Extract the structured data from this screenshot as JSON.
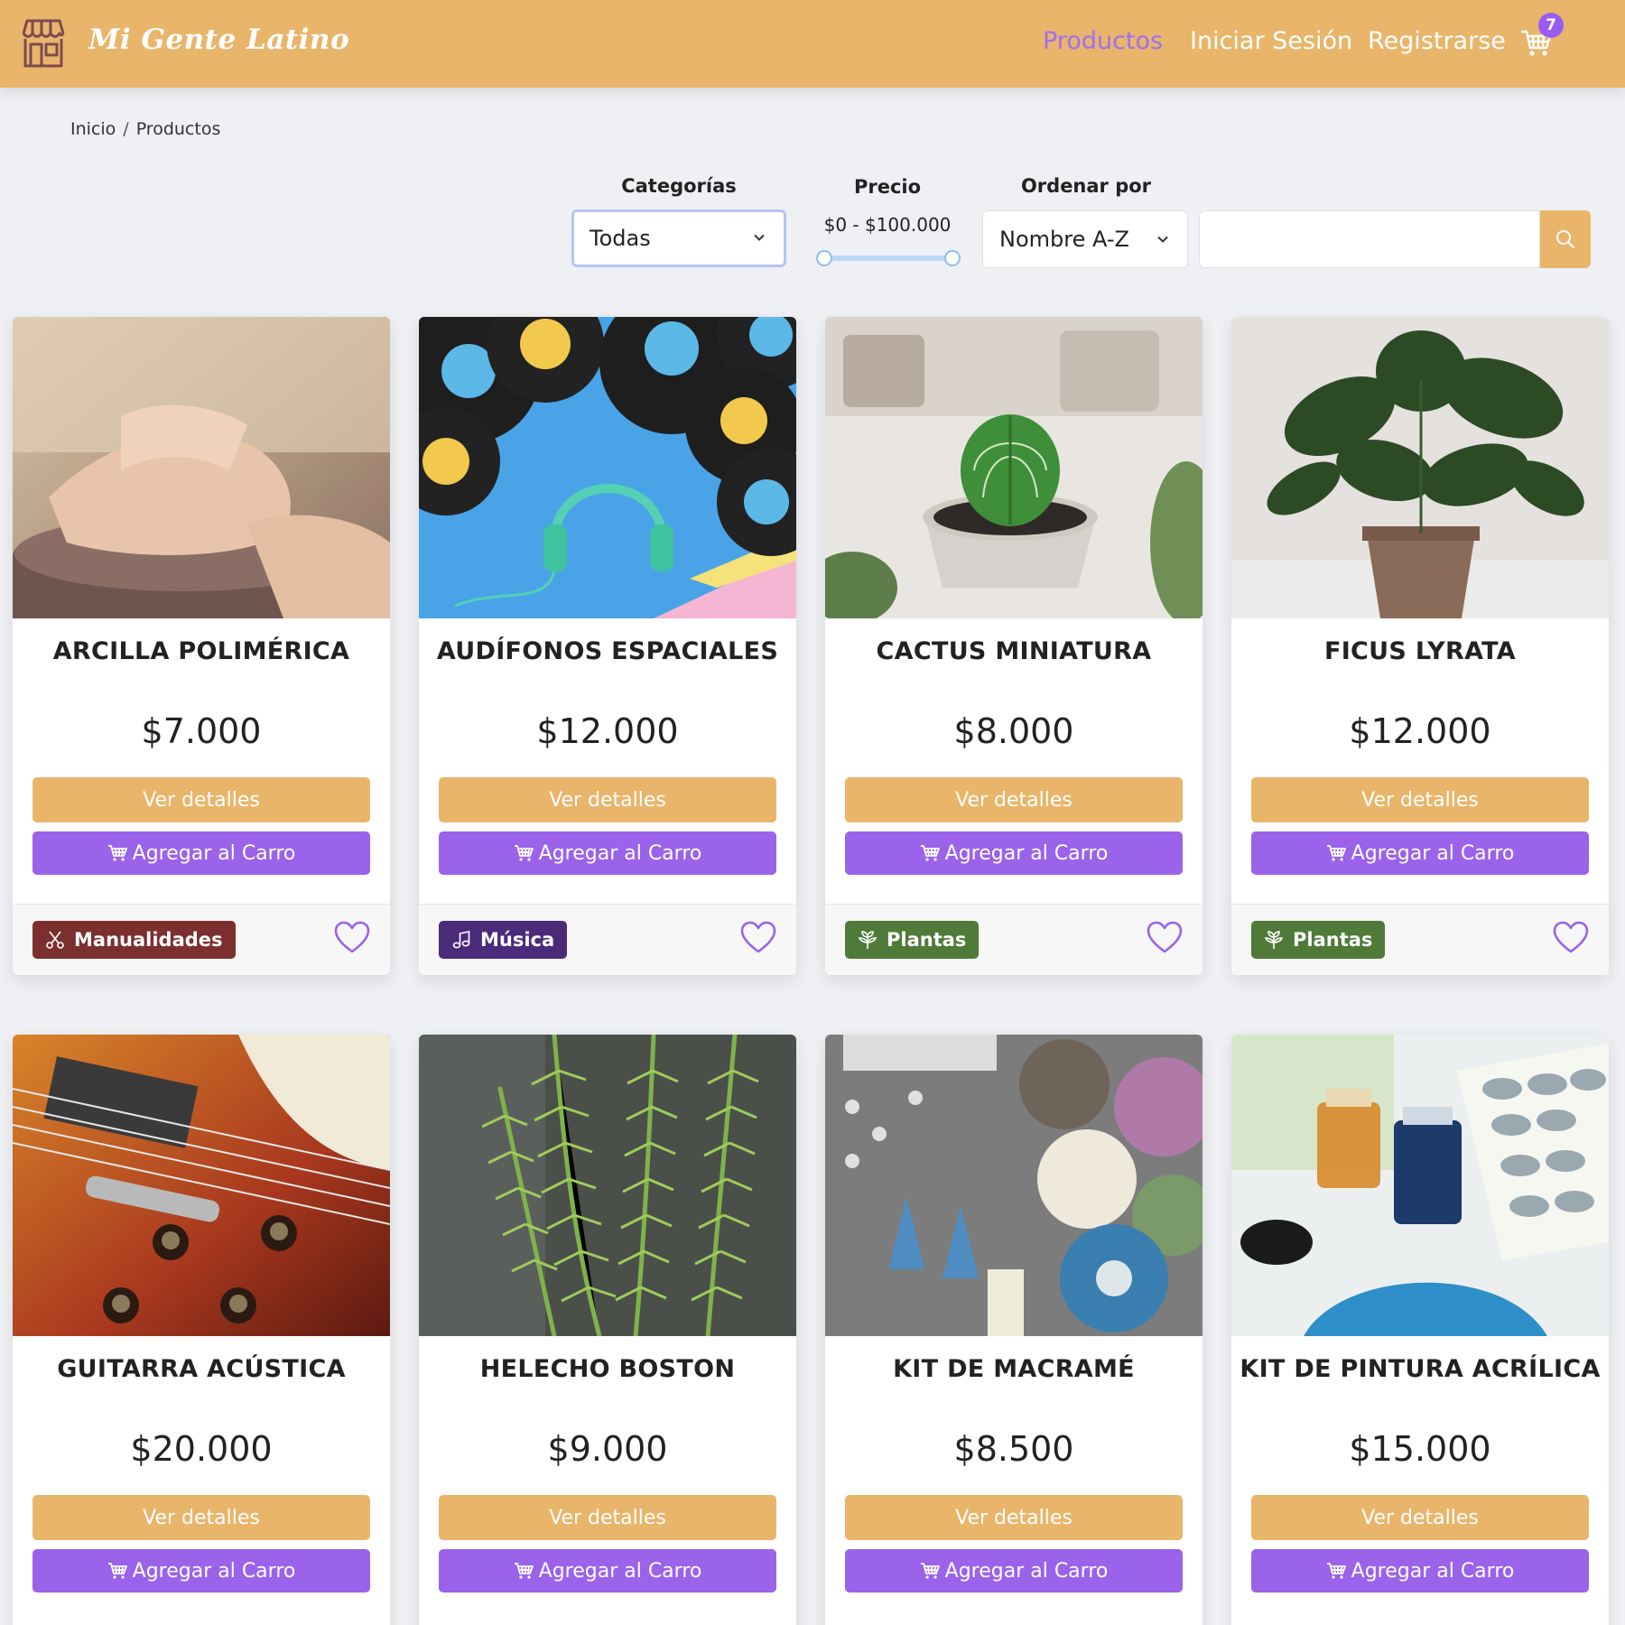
{
  "header": {
    "brand": "Mi Gente Latino",
    "nav": {
      "products": "Productos",
      "login": "Iniciar Sesión",
      "register": "Registrarse"
    },
    "cart_count": "7",
    "colors": {
      "bar": "#e9b56a",
      "active": "#a06ff0",
      "badge": "#9a5cf0"
    }
  },
  "breadcrumb": {
    "home": "Inicio",
    "separator": "/",
    "current": "Productos"
  },
  "filters": {
    "category_label": "Categorías",
    "category_value": "Todas",
    "price_label": "Precio",
    "price_range": "$0 - $100.000",
    "order_label": "Ordenar por",
    "order_value": "Nombre A-Z",
    "search_value": ""
  },
  "card_labels": {
    "details": "Ver detalles",
    "add_to_cart": "Agregar al Carro"
  },
  "products": [
    {
      "name": "ARCILLA POLIMÉRICA",
      "price": "$7.000",
      "category": "Manualidades",
      "category_icon": "scissors-icon",
      "category_color": "#7c2f2f"
    },
    {
      "name": "AUDÍFONOS ESPACIALES",
      "price": "$12.000",
      "category": "Música",
      "category_icon": "music-note-icon",
      "category_color": "#4b2a7a"
    },
    {
      "name": "CACTUS MINIATURA",
      "price": "$8.000",
      "category": "Plantas",
      "category_icon": "plant-icon",
      "category_color": "#4f7a37"
    },
    {
      "name": "FICUS LYRATA",
      "price": "$12.000",
      "category": "Plantas",
      "category_icon": "plant-icon",
      "category_color": "#4f7a37"
    },
    {
      "name": "GUITARRA ACÚSTICA",
      "price": "$20.000"
    },
    {
      "name": "HELECHO BOSTON",
      "price": "$9.000"
    },
    {
      "name": "KIT DE MACRAMÉ",
      "price": "$8.500"
    },
    {
      "name": "KIT DE PINTURA ACRÍLICA",
      "price": "$15.000"
    }
  ]
}
